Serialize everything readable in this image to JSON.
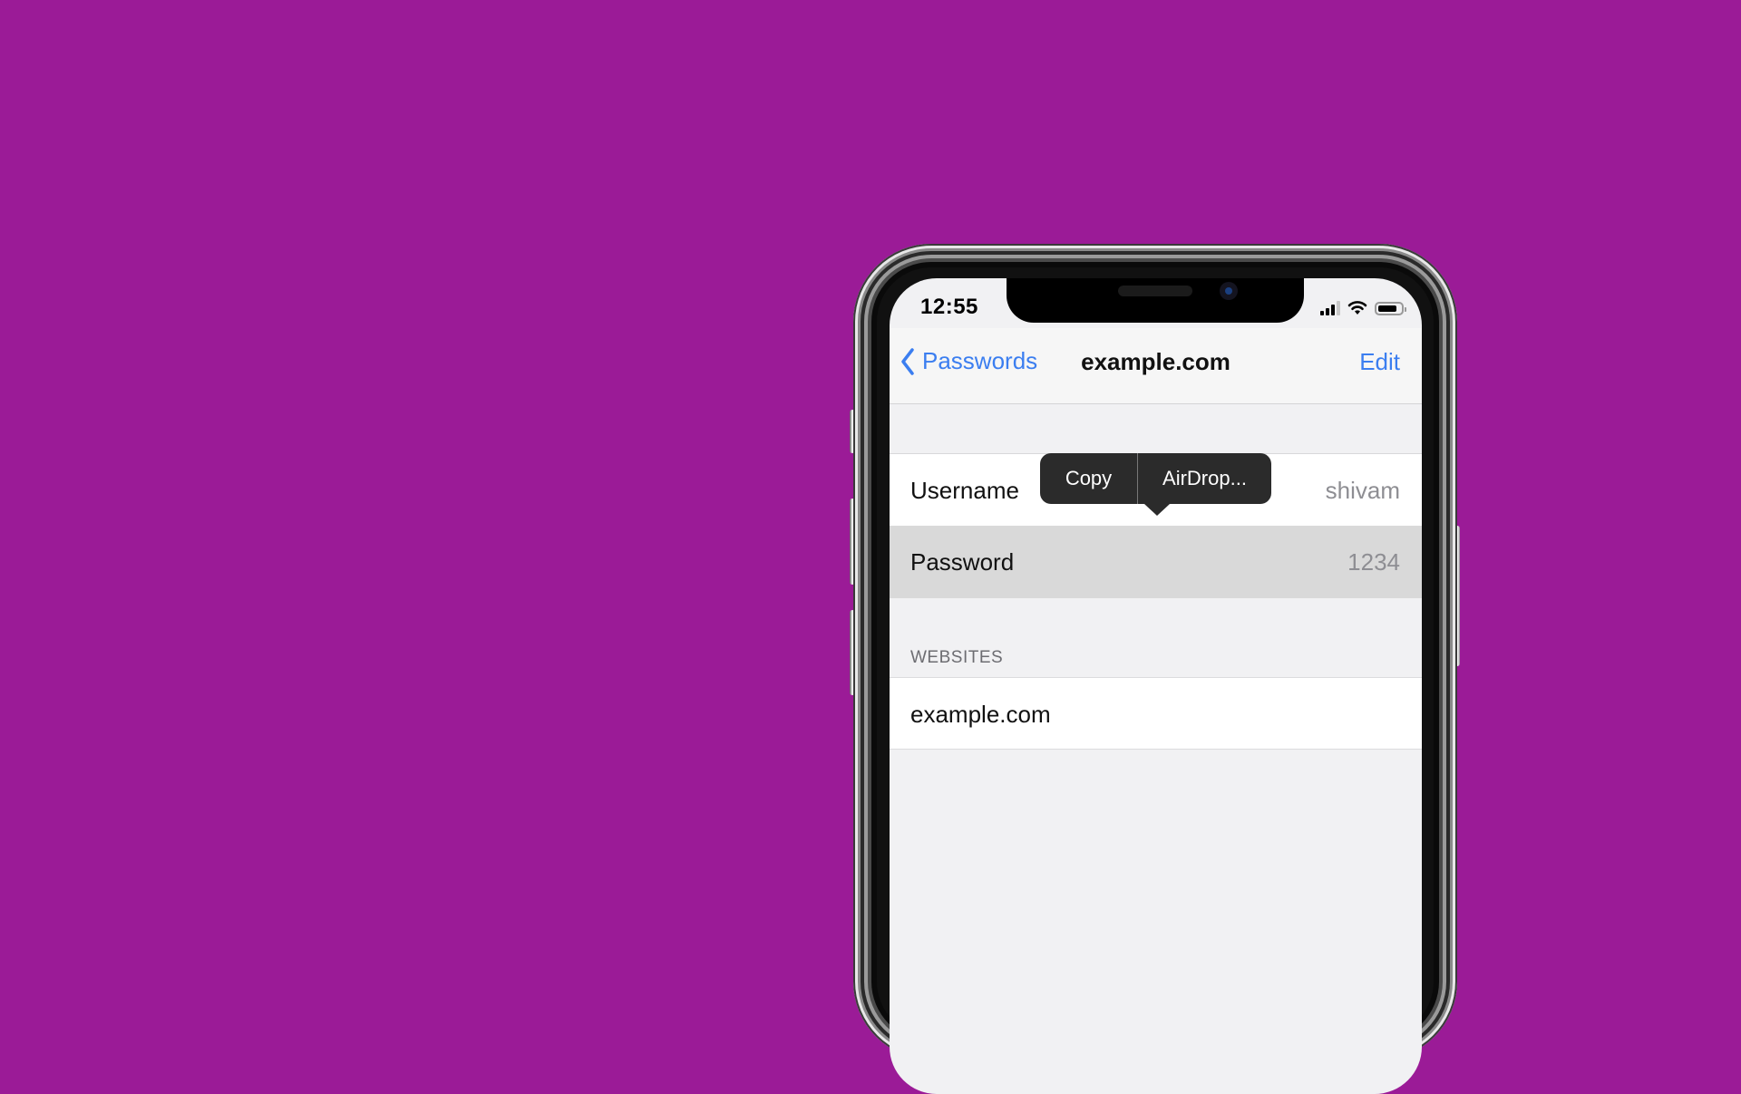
{
  "background_color": "#9b1b97",
  "accent_color": "#3b7ef0",
  "status_bar": {
    "time": "12:55",
    "signal_icon": "cellular-signal-icon",
    "signal_bars_active": 3,
    "signal_bars_total": 4,
    "wifi_icon": "wifi-icon",
    "battery_icon": "battery-icon",
    "battery_level_percent": 75
  },
  "nav": {
    "back_label": "Passwords",
    "title": "example.com",
    "edit_label": "Edit"
  },
  "credentials": [
    {
      "label": "Username",
      "value": "shivam"
    },
    {
      "label": "Password",
      "value": "1234"
    }
  ],
  "context_menu": {
    "items": [
      "Copy",
      "AirDrop..."
    ]
  },
  "websites": {
    "header": "WEBSITES",
    "items": [
      "example.com"
    ]
  }
}
